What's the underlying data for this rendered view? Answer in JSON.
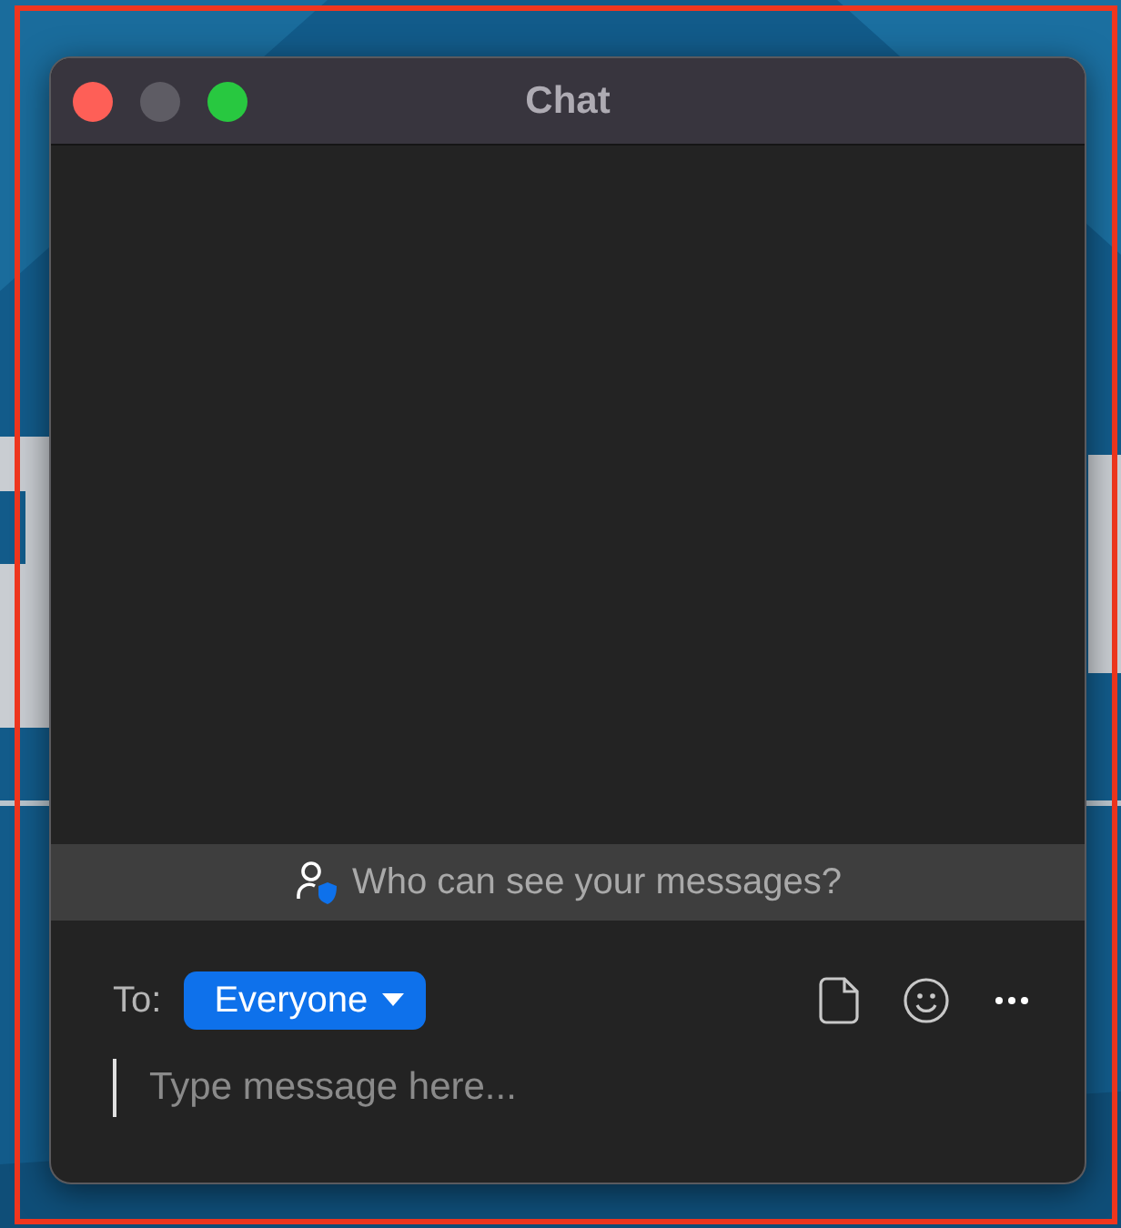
{
  "window": {
    "title": "Chat",
    "controls": [
      {
        "kind": "close",
        "disabled": false
      },
      {
        "kind": "minimize",
        "disabled": true
      },
      {
        "kind": "zoom",
        "disabled": false
      }
    ]
  },
  "notice": {
    "text": "Who can see your messages?"
  },
  "compose": {
    "to_label": "To:",
    "recipient": "Everyone",
    "tools": [
      {
        "kind": "file"
      },
      {
        "kind": "emoji"
      },
      {
        "kind": "more"
      }
    ],
    "placeholder": "Type message here..."
  }
}
